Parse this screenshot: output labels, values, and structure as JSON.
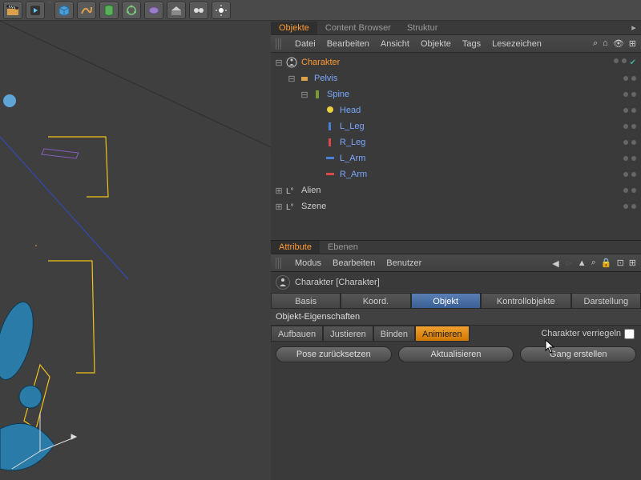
{
  "toolbar": {
    "icons": [
      "clapperboard",
      "cube",
      "path",
      "torus",
      "gear",
      "light",
      "grid",
      "eyes",
      "record"
    ]
  },
  "panel_tabs": {
    "items": [
      "Objekte",
      "Content Browser",
      "Struktur"
    ],
    "active": 0
  },
  "object_menu": {
    "items": [
      "Datei",
      "Bearbeiten",
      "Ansicht",
      "Objekte",
      "Tags",
      "Lesezeichen"
    ]
  },
  "hierarchy": [
    {
      "label": "Charakter",
      "depth": 0,
      "exp": "⊟",
      "icon": "char",
      "sel": true,
      "check": true
    },
    {
      "label": "Pelvis",
      "depth": 1,
      "exp": "⊟",
      "icon": "pelvis",
      "blue": true
    },
    {
      "label": "Spine",
      "depth": 2,
      "exp": "⊟",
      "icon": "spine",
      "blue": true
    },
    {
      "label": "Head",
      "depth": 3,
      "exp": "",
      "icon": "head",
      "blue": true
    },
    {
      "label": "L_Leg",
      "depth": 3,
      "exp": "",
      "icon": "lleg",
      "blue": true
    },
    {
      "label": "R_Leg",
      "depth": 3,
      "exp": "",
      "icon": "rleg",
      "blue": true
    },
    {
      "label": "L_Arm",
      "depth": 3,
      "exp": "",
      "icon": "larm",
      "blue": true
    },
    {
      "label": "R_Arm",
      "depth": 3,
      "exp": "",
      "icon": "rarm",
      "blue": true
    },
    {
      "label": "Alien",
      "depth": 0,
      "exp": "⊞",
      "icon": "null"
    },
    {
      "label": "Szene",
      "depth": 0,
      "exp": "⊞",
      "icon": "null"
    }
  ],
  "attr_tabs": {
    "items": [
      "Attribute",
      "Ebenen"
    ],
    "active": 0
  },
  "attr_menu": {
    "items": [
      "Modus",
      "Bearbeiten",
      "Benutzer"
    ]
  },
  "attr_header": "Charakter [Charakter]",
  "main_tabs": {
    "items": [
      "Basis",
      "Koord.",
      "Objekt",
      "Kontrollobjekte",
      "Darstellung"
    ],
    "active": 2
  },
  "section_title": "Objekt-Eigenschaften",
  "subtabs": {
    "items": [
      "Aufbauen",
      "Justieren",
      "Binden",
      "Animieren"
    ],
    "active": 3
  },
  "lock_label": "Charakter verriegeln",
  "actions": {
    "reset": "Pose zurücksetzen",
    "update": "Aktualisieren",
    "walk": "Gang erstellen"
  },
  "colors": {
    "accent_orange": "#ff9933",
    "accent_blue": "#5a7fb5"
  }
}
